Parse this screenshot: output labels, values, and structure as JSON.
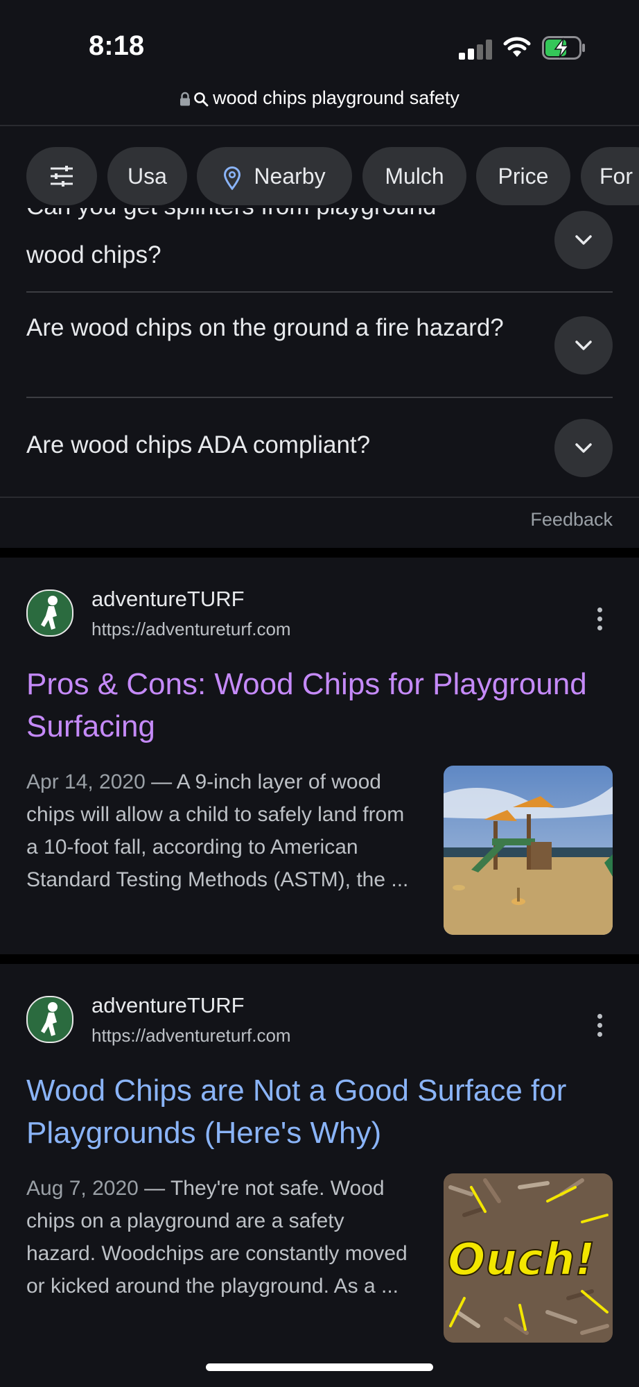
{
  "status": {
    "time": "8:18"
  },
  "address_bar": {
    "query": "wood chips playground safety"
  },
  "chips": [
    {
      "label": ""
    },
    {
      "label": "Usa"
    },
    {
      "label": "Nearby"
    },
    {
      "label": "Mulch"
    },
    {
      "label": "Price"
    },
    {
      "label": "For"
    }
  ],
  "faq": {
    "cut_question": "Can you get splinters from playground",
    "items": [
      {
        "question": "wood chips?"
      },
      {
        "question": "Are wood chips on the ground a fire hazard?"
      },
      {
        "question": "Are wood chips ADA compliant?"
      }
    ],
    "feedback": "Feedback"
  },
  "results": [
    {
      "site": "adventureTURF",
      "url": "https://adventureturf.com",
      "title": "Pros & Cons: Wood Chips for Playground Surfacing",
      "title_color": "#c58af9",
      "date": "Apr 14, 2020",
      "snippet": " — A 9-inch layer of wood chips will allow a child to safely land from a 10-foot fall, according to American Standard Testing Methods (ASTM), the ..."
    },
    {
      "site": "adventureTURF",
      "url": "https://adventureturf.com",
      "title": "Wood Chips are Not a Good Surface for Playgrounds (Here's Why)",
      "title_color": "#8ab4f8",
      "date": "Aug 7, 2020",
      "snippet": " — They're not safe. Wood chips on a playground are a safety hazard. Woodchips are constantly moved or kicked around the playground. As a ...",
      "image_text": "Ouch!"
    }
  ]
}
